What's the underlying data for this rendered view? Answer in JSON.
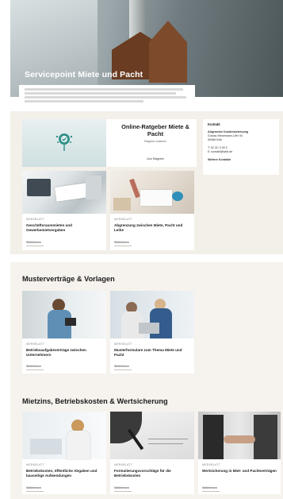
{
  "hero": {
    "title": "Servicepoint Miete und Pacht"
  },
  "ratgeber": {
    "title": "Online-Ratgeber Miete & Pacht",
    "subtitle": "Ratgeber ansehen",
    "link": "Zum Ratgeber"
  },
  "contact": {
    "heading": "Kontakt",
    "org": "Allgemeine Kundenbetreuung",
    "line1": "Gustav-Heinemann-Ufer 94",
    "line2": "50968 Köln",
    "phone": "T: 02 21/ 3 90 0",
    "email": "E: kontakt@wbb.de",
    "link": "Weitere Kontakte"
  },
  "top_cards": [
    {
      "tag": "Merkblatt",
      "title": "Geschäftsraummieten und Gewerbemietvergaben",
      "more": "Weiterlesen"
    },
    {
      "tag": "Merkblatt",
      "title": "Abgrenzung zwischen Miete, Pacht und Leihe",
      "more": "Weiterlesen"
    }
  ],
  "section_vorlagen": {
    "title": "Musterverträge & Vorlagen",
    "cards": [
      {
        "tag": "Merkblatt",
        "title": "Betriebsaufgabeverträge zwischen Unternehmern",
        "more": "Weiterlesen"
      },
      {
        "tag": "Merkblatt",
        "title": "Musterformulare zum Thema Miete und Pacht",
        "more": "Weiterlesen"
      }
    ]
  },
  "section_mietzins": {
    "title": "Mietzins, Betriebskosten & Wertsicherung",
    "cards": [
      {
        "tag": "Merkblatt",
        "title": "Betriebskosten, öffentliche Abgaben und bauseitige Aufwendungen",
        "more": "Weiterlesen"
      },
      {
        "tag": "Merkblatt",
        "title": "Formulierungsvorschläge für die Betriebskosten",
        "more": "Weiterlesen"
      },
      {
        "tag": "Merkblatt",
        "title": "Wertsicherung in Miet- und Pachtverträgen",
        "more": "Weiterlesen"
      }
    ]
  }
}
